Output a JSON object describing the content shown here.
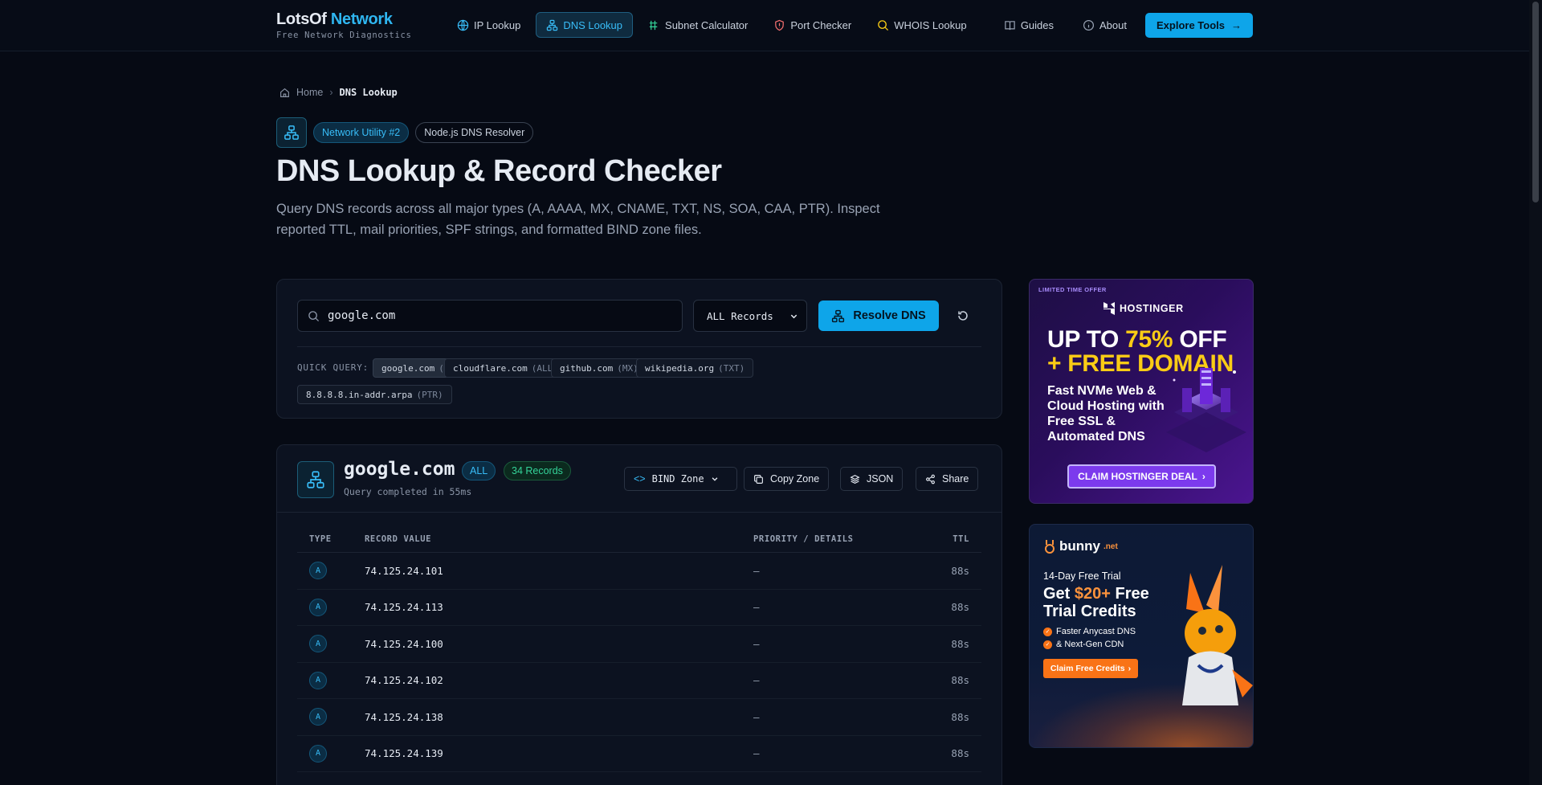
{
  "brand": {
    "name_part1": "LotsOf",
    "name_part2": "Network",
    "tagline": "Free Network Diagnostics"
  },
  "nav": {
    "items": [
      {
        "label": "IP Lookup",
        "icon": "globe-icon"
      },
      {
        "label": "DNS Lookup",
        "icon": "network-icon",
        "active": true
      },
      {
        "label": "Subnet Calculator",
        "icon": "grid-icon"
      },
      {
        "label": "Port Checker",
        "icon": "shield-icon"
      },
      {
        "label": "WHOIS Lookup",
        "icon": "search-icon"
      }
    ],
    "guides": "Guides",
    "about": "About",
    "explore": "Explore Tools"
  },
  "breadcrumb": {
    "home": "Home",
    "current": "DNS Lookup"
  },
  "hero": {
    "badge_primary": "Network Utility #2",
    "badge_secondary": "Node.js DNS Resolver",
    "title": "DNS Lookup & Record Checker",
    "description": "Query DNS records across all major types (A, AAAA, MX, CNAME, TXT, NS, SOA, CAA, PTR). Inspect reported TTL, mail priorities, SPF strings, and formatted BIND zone files."
  },
  "query": {
    "input_value": "google.com",
    "record_type": "ALL Records",
    "resolve_label": "Resolve DNS",
    "quick_label": "QUICK QUERY:",
    "quick": [
      {
        "domain": "google.com",
        "type": "(ALL)",
        "selected": true
      },
      {
        "domain": "cloudflare.com",
        "type": "(ALL)"
      },
      {
        "domain": "github.com",
        "type": "(MX)"
      },
      {
        "domain": "wikipedia.org",
        "type": "(TXT)"
      },
      {
        "domain": "8.8.8.8.in-addr.arpa",
        "type": "(PTR)"
      }
    ]
  },
  "result": {
    "domain": "google.com",
    "type_badge": "ALL",
    "count_badge": "34 Records",
    "time": "Query completed in 55ms",
    "actions": {
      "bind": "BIND Zone",
      "copy": "Copy Zone",
      "json": "JSON",
      "share": "Share"
    },
    "columns": {
      "type": "TYPE",
      "value": "RECORD VALUE",
      "priority": "PRIORITY / DETAILS",
      "ttl": "TTL"
    },
    "rows": [
      {
        "type": "A",
        "value": "74.125.24.101",
        "priority": "—",
        "ttl": "88s"
      },
      {
        "type": "A",
        "value": "74.125.24.113",
        "priority": "—",
        "ttl": "88s"
      },
      {
        "type": "A",
        "value": "74.125.24.100",
        "priority": "—",
        "ttl": "88s"
      },
      {
        "type": "A",
        "value": "74.125.24.102",
        "priority": "—",
        "ttl": "88s"
      },
      {
        "type": "A",
        "value": "74.125.24.138",
        "priority": "—",
        "ttl": "88s"
      },
      {
        "type": "A",
        "value": "74.125.24.139",
        "priority": "—",
        "ttl": "88s"
      }
    ]
  },
  "ads": {
    "hostinger": {
      "tag": "LIMITED TIME OFFER",
      "logo": "HOSTINGER",
      "head_line1_pre": "UP TO ",
      "head_line1_hl": "75%",
      "head_line1_post": " OFF",
      "head_line2": "+ FREE DOMAIN",
      "sub": "Fast NVMe Web & Cloud Hosting with Free SSL & Automated DNS",
      "cta": "CLAIM HOSTINGER DEAL"
    },
    "bunny": {
      "logo": "bunny",
      "logo_suffix": ".net",
      "trial": "14-Day Free Trial",
      "head_pre": "Get ",
      "head_hl": "$20+",
      "head_post": " Free Trial Credits",
      "feat1": "Faster Anycast DNS",
      "feat2": "& Next-Gen CDN",
      "cta": "Claim Free Credits"
    }
  },
  "colors": {
    "accent": "#0ea5e9",
    "background": "#060a14",
    "success": "#34d399"
  }
}
